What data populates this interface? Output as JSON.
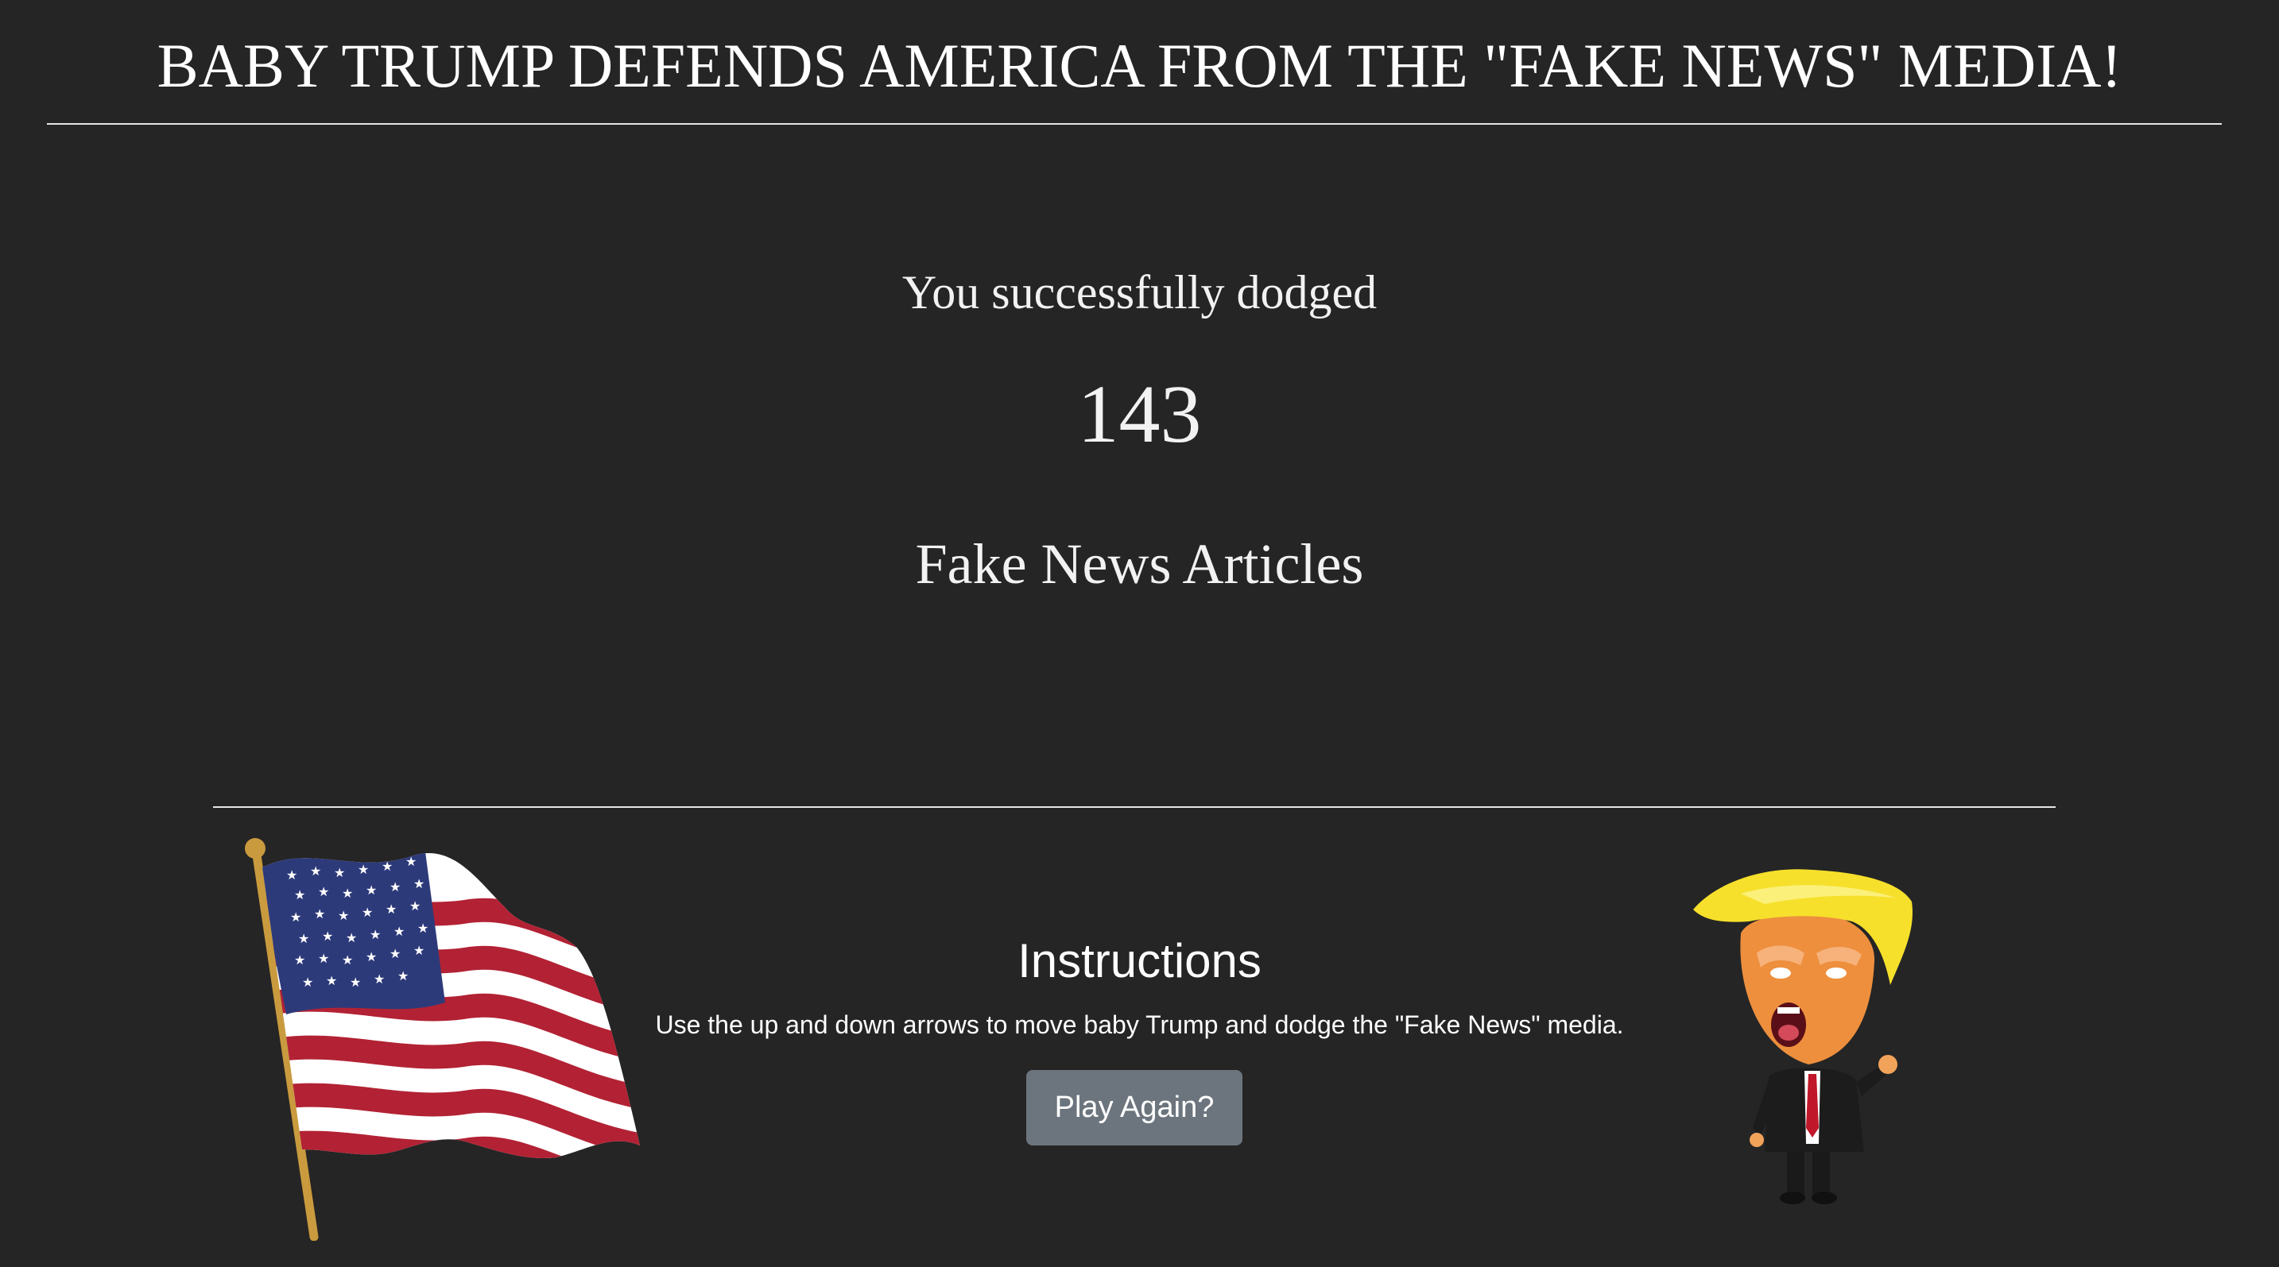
{
  "header": {
    "title": "BABY TRUMP DEFENDS AMERICA FROM THE \"FAKE NEWS\" MEDIA!"
  },
  "result": {
    "dodged_label": "You successfully dodged",
    "score": "143",
    "unit_label": "Fake News Articles"
  },
  "instructions": {
    "title": "Instructions",
    "text": "Use the up and down arrows to move baby Trump and dodge the \"Fake News\" media.",
    "play_again_label": "Play Again?"
  },
  "colors": {
    "background": "#252525",
    "text": "#ffffff",
    "button": "#6c757d",
    "flag_red": "#b22234",
    "flag_blue": "#3c3b6e",
    "hair_yellow": "#f5e030",
    "skin_orange": "#f0a050"
  },
  "images": {
    "left": "american-flag",
    "right": "cartoon-trump-character"
  }
}
